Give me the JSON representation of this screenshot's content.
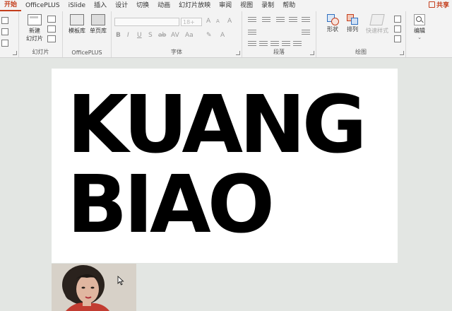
{
  "tabs": [
    {
      "label": "开始",
      "active": true
    },
    {
      "label": "OfficePLUS"
    },
    {
      "label": "iSlide"
    },
    {
      "label": "插入"
    },
    {
      "label": "设计"
    },
    {
      "label": "切换"
    },
    {
      "label": "动画"
    },
    {
      "label": "幻灯片放映"
    },
    {
      "label": "审阅"
    },
    {
      "label": "视图"
    },
    {
      "label": "录制"
    },
    {
      "label": "帮助"
    }
  ],
  "share_label": "共享",
  "ribbon": {
    "slides_group": {
      "new_slide_line1": "新建",
      "new_slide_line2": "幻灯片",
      "label": "幻灯片"
    },
    "officeplus_group": {
      "template_library": "模板库",
      "icon_library": "单页库",
      "label": "OfficePLUS"
    },
    "font_group": {
      "size_value": "18+",
      "label": "字体"
    },
    "paragraph_group": {
      "label": "段落"
    },
    "drawing_group": {
      "shapes": "形状",
      "arrange": "排列",
      "quick_styles": "快速样式",
      "label": "绘图"
    },
    "editing_group": {
      "label": "编辑"
    }
  },
  "slide": {
    "line1": "KUANG",
    "line2": "BIAO"
  },
  "colors": {
    "accent": "#c43e1c",
    "canvas_background": "#e3e6e3",
    "ribbon_background": "#f3f3f3",
    "slide_background": "#ffffff",
    "slide_text": "#000000"
  }
}
